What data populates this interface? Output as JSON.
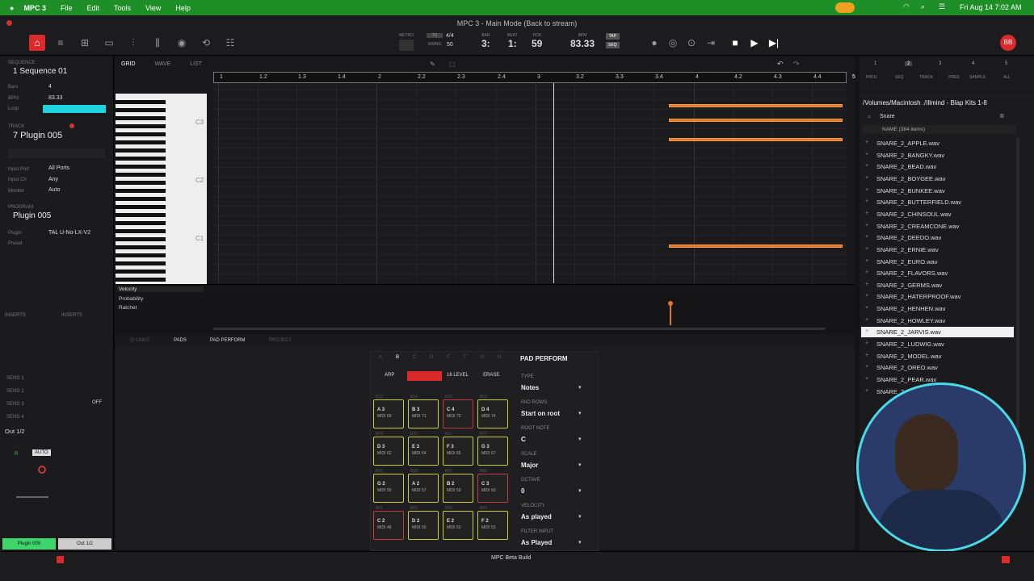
{
  "menubar": {
    "app": "MPC 3",
    "items": [
      "File",
      "Edit",
      "Tools",
      "View",
      "Help"
    ],
    "datetime": "Fri Aug 14  7:02 AM"
  },
  "titlebar": {
    "title": "MPC 3 - Main Mode (Back to stream)"
  },
  "transport": {
    "metro_label": "METRO",
    "tc_label": "TC",
    "time_sig": "4/4",
    "swing_label": "SWING",
    "swing": "50",
    "bar_label": "BAR",
    "bar": "3:",
    "beat_label": "BEAT",
    "beat": "1:",
    "tick_label": "TICK",
    "tick": "59",
    "bpm_label": "BPM",
    "bpm": "83.33",
    "tap": "TAP",
    "seq": "SEQ"
  },
  "left": {
    "sequence_section": "SEQUENCE",
    "sequence": "1 Sequence 01",
    "bars_label": "Bars",
    "bars": "4",
    "bpm_label": "BPM",
    "bpm": "83.33",
    "loop_label": "Loop",
    "track_section": "TRACK",
    "track": "7 Plugin 005",
    "input_port_label": "Input Port",
    "input_port": "All Ports",
    "input_ch_label": "Input Ch",
    "input_ch": "Any",
    "monitor_label": "Monitor",
    "monitor": "Auto",
    "program_section": "PROGRAM",
    "program": "Plugin 005",
    "plugin_label": "Plugin",
    "plugin": "TAL U-No-LX-V2",
    "preset_label": "Preset",
    "inserts_a": "INSERTS",
    "inserts_b": "INSERTS",
    "sends": [
      "SEND 1",
      "SEND 2",
      "SEND 3",
      "SEND 4"
    ],
    "out": "Out 1/2",
    "r": "R",
    "auto": "AUTO",
    "off": "OFF",
    "ch_a": "Plugin 005",
    "ch_b": "Out 1/2"
  },
  "grid": {
    "tabs": [
      "GRID",
      "WAVE",
      "LIST"
    ],
    "ruler": [
      "1",
      "1.2",
      "1.3",
      "1.4",
      "2",
      "2.2",
      "2.3",
      "2.4",
      "3",
      "3.2",
      "3.3",
      "3.4",
      "4",
      "4.2",
      "4.3",
      "4.4",
      "5"
    ],
    "key_labels": [
      "C3",
      "C2",
      "C1"
    ],
    "lanes": [
      "Velocity",
      "Probability",
      "Ratchet"
    ]
  },
  "bottom_tabs": [
    "Q-LINKS",
    "PADS",
    "PAD PERFORM",
    "PROJECT"
  ],
  "pad_perform": {
    "title": "PAD PERFORM",
    "banks": [
      "A",
      "B",
      "C",
      "D",
      "E",
      "F",
      "G",
      "H"
    ],
    "buttons": [
      "ARP",
      "FULL LEVEL",
      "16 LEVEL",
      "ERASE"
    ],
    "pads": [
      {
        "label": "B13",
        "note": "A 3",
        "midi": "MIDI 69"
      },
      {
        "label": "B14",
        "note": "B 3",
        "midi": "MIDI 71"
      },
      {
        "label": "B15",
        "note": "C 4",
        "midi": "MIDI 72"
      },
      {
        "label": "B16",
        "note": "D 4",
        "midi": "MIDI 74"
      },
      {
        "label": "B09",
        "note": "D 3",
        "midi": "MIDI 62"
      },
      {
        "label": "B10",
        "note": "E 3",
        "midi": "MIDI 64"
      },
      {
        "label": "B11",
        "note": "F 3",
        "midi": "MIDI 65"
      },
      {
        "label": "B12",
        "note": "G 3",
        "midi": "MIDI 67"
      },
      {
        "label": "B05",
        "note": "G 2",
        "midi": "MIDI 55"
      },
      {
        "label": "B06",
        "note": "A 2",
        "midi": "MIDI 57"
      },
      {
        "label": "B07",
        "note": "B 2",
        "midi": "MIDI 59"
      },
      {
        "label": "B08",
        "note": "C 3",
        "midi": "MIDI 60"
      },
      {
        "label": "B01",
        "note": "C 2",
        "midi": "MIDI 48"
      },
      {
        "label": "B02",
        "note": "D 2",
        "midi": "MIDI 50"
      },
      {
        "label": "B03",
        "note": "E 2",
        "midi": "MIDI 52"
      },
      {
        "label": "B04",
        "note": "F 2",
        "midi": "MIDI 53"
      }
    ],
    "fields": [
      {
        "label": "TYPE",
        "value": "Notes"
      },
      {
        "label": "PAD ROWS",
        "value": "Start on root"
      },
      {
        "label": "ROOT NOTE",
        "value": "C"
      },
      {
        "label": "SCALE",
        "value": "Major"
      },
      {
        "label": "OCTAVE",
        "value": "0"
      },
      {
        "label": "VELOCITY",
        "value": "As played"
      },
      {
        "label": "FILTER INPUT",
        "value": "As Played"
      }
    ]
  },
  "browser": {
    "tabs": [
      "1",
      "2",
      "3",
      "4",
      "5"
    ],
    "tab_labels": [
      "PROJ",
      "SEQ",
      "TRACK",
      "PRES",
      "SAMPLE",
      "ALL"
    ],
    "path": "/Volumes/Macintosh ./Illmind - Blap Kits 1-8",
    "search": "Snare",
    "header": "NAME (384 items)",
    "files": [
      "SNARE_2_APPLE.wav",
      "SNARE_2_BANGKY.wav",
      "SNARE_2_BEAD.wav",
      "SNARE_2_BOYGEE.wav",
      "SNARE_2_BUNKEE.wav",
      "SNARE_2_BUTTERFIELD.wav",
      "SNARE_2_CHINSOUL.wav",
      "SNARE_2_CREAMCONE.wav",
      "SNARE_2_DEEDO.wav",
      "SNARE_2_ERNIE.wav",
      "SNARE_2_EURO.wav",
      "SNARE_2_FLAVORS.wav",
      "SNARE_2_GERMS.wav",
      "SNARE_2_HATERPROOF.wav",
      "SNARE_2_HENHEN.wav",
      "SNARE_2_HOWLEY.wav",
      "SNARE_2_JARVIS.wav",
      "SNARE_2_LUDWIG.wav",
      "SNARE_2_MODEL.wav",
      "SNARE_2_OREO.wav",
      "SNARE_2_PEAR.wav",
      "SNARE_2_"
    ],
    "selected": "SNARE_2_JARVIS.wav"
  },
  "status": {
    "build": "MPC Beta Build"
  },
  "colors": {
    "accent": "#e8742a",
    "menubar": "#1e8f26",
    "pad_border": "#c8cc3c",
    "loop": "#1fd4e0",
    "webcam_ring": "#49d9e8"
  }
}
